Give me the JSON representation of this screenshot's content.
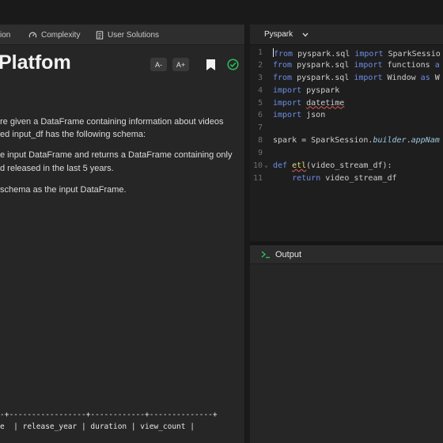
{
  "left_panel": {
    "tabs": [
      {
        "label": "ion",
        "icon": "document-icon"
      },
      {
        "label": "Complexity",
        "icon": "gauge-icon"
      },
      {
        "label": "User Solutions",
        "icon": "list-icon"
      }
    ],
    "title": "Platfom",
    "font_decrease": "A-",
    "font_increase": "A+",
    "paragraphs": [
      "re given a DataFrame containing information about videos",
      "ed input_df has the following schema:",
      "e input DataFrame and returns a DataFrame containing only",
      "d released in the last 5 years.",
      "schema as the input DataFrame."
    ],
    "schema_border": "-+-----------------+------------+--------------+",
    "schema_header": "e  | release_year | duration | view_count |"
  },
  "editor": {
    "language": "Pyspark",
    "lines": [
      {
        "n": "1",
        "tokens": [
          [
            "kw",
            "from"
          ],
          [
            "mod",
            " pyspark.sql "
          ],
          [
            "kw",
            "import"
          ],
          [
            "mod",
            " SparkSessio"
          ]
        ],
        "caret": true
      },
      {
        "n": "2",
        "tokens": [
          [
            "kw",
            "from"
          ],
          [
            "mod",
            " pyspark.sql "
          ],
          [
            "kw",
            "import"
          ],
          [
            "mod",
            " functions "
          ],
          [
            "kw",
            "a"
          ]
        ]
      },
      {
        "n": "3",
        "tokens": [
          [
            "kw",
            "from"
          ],
          [
            "mod",
            " pyspark.sql "
          ],
          [
            "kw",
            "import"
          ],
          [
            "mod",
            " Window "
          ],
          [
            "kw",
            "as"
          ],
          [
            "mod",
            " W"
          ]
        ]
      },
      {
        "n": "4",
        "tokens": [
          [
            "kw",
            "import"
          ],
          [
            "mod",
            " pyspark"
          ]
        ]
      },
      {
        "n": "5",
        "tokens": [
          [
            "kw",
            "import"
          ],
          [
            "mod",
            " "
          ],
          [
            "squig",
            "datetime"
          ]
        ]
      },
      {
        "n": "6",
        "tokens": [
          [
            "kw",
            "import"
          ],
          [
            "mod",
            " json"
          ]
        ]
      },
      {
        "n": "7",
        "tokens": []
      },
      {
        "n": "8",
        "tokens": [
          [
            "mod",
            "spark = SparkSession."
          ],
          [
            "it",
            "builder"
          ],
          [
            "mod",
            "."
          ],
          [
            "it",
            "appNam"
          ]
        ]
      },
      {
        "n": "9",
        "tokens": []
      },
      {
        "n": "10",
        "fold": true,
        "tokens": [
          [
            "kw",
            "def"
          ],
          [
            "mod",
            " "
          ],
          [
            "fnsq",
            "etl"
          ],
          [
            "mod",
            "(video_stream_df):"
          ]
        ]
      },
      {
        "n": "11",
        "tokens": [
          [
            "mod",
            "    "
          ],
          [
            "kw",
            "return"
          ],
          [
            "mod",
            " video_stream_df"
          ]
        ]
      }
    ]
  },
  "output": {
    "title": "Output",
    "icon": "terminal-icon"
  }
}
